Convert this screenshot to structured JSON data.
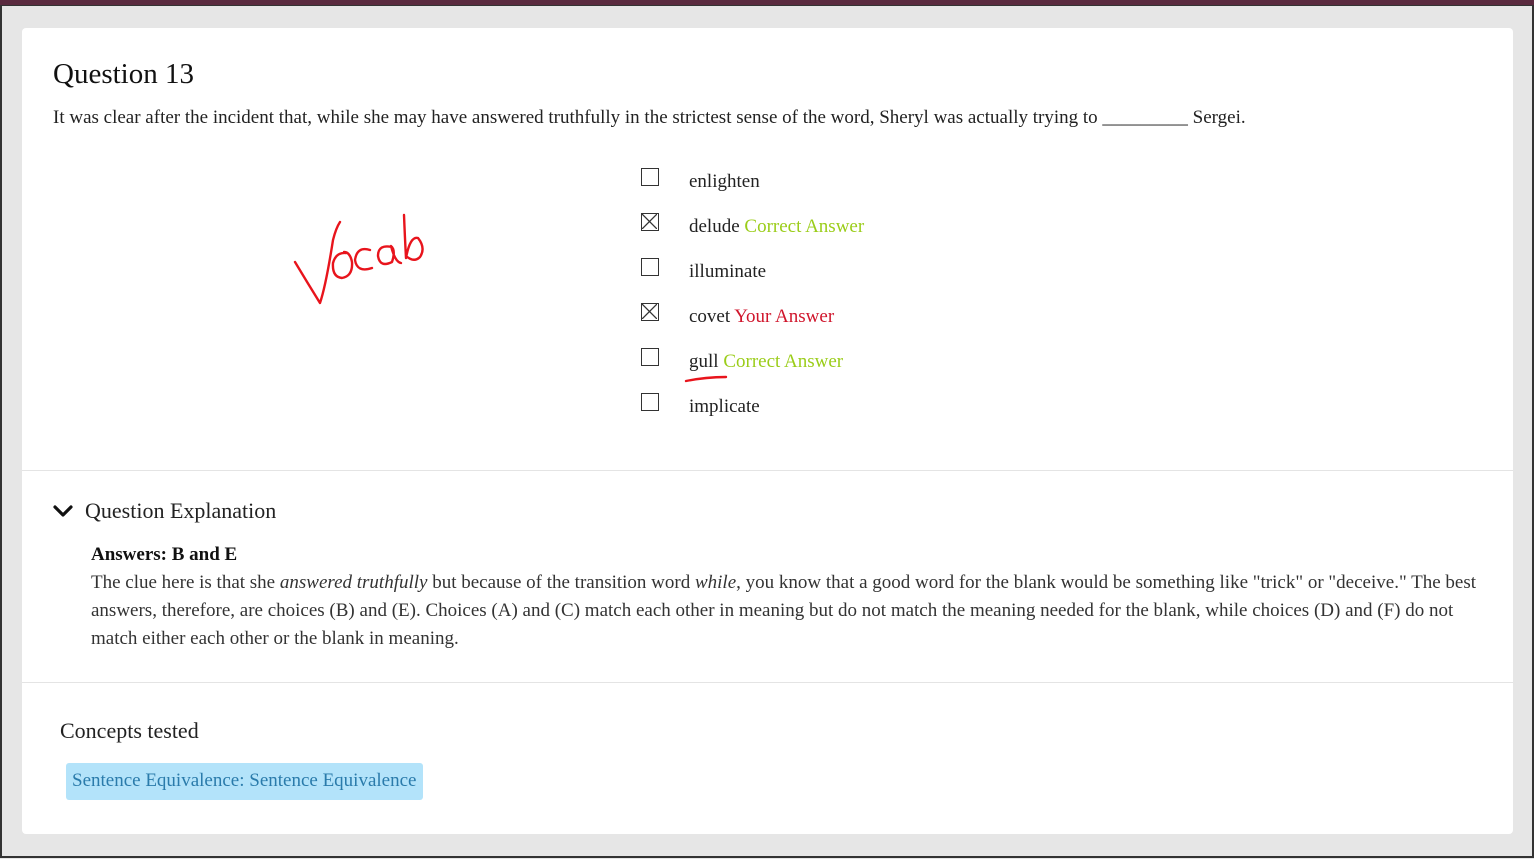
{
  "question": {
    "title": "Question 13",
    "stem": "It was clear after the incident that, while she may have answered truthfully in the strictest sense of the word, Sheryl was actually trying to _________ Sergei."
  },
  "choices": [
    {
      "text": "enlighten",
      "checked": false,
      "tag": "",
      "tag_type": ""
    },
    {
      "text": "delude",
      "checked": true,
      "tag": "Correct Answer",
      "tag_type": "correct"
    },
    {
      "text": "illuminate",
      "checked": false,
      "tag": "",
      "tag_type": ""
    },
    {
      "text": "covet",
      "checked": true,
      "tag": "Your Answer",
      "tag_type": "yours"
    },
    {
      "text": "gull",
      "checked": false,
      "tag": "Correct Answer",
      "tag_type": "correct"
    },
    {
      "text": "implicate",
      "checked": false,
      "tag": "",
      "tag_type": ""
    }
  ],
  "explanation": {
    "toggle_label": "Question Explanation",
    "answers_label": "Answers: B and E",
    "p1": "The clue here is that she ",
    "p1_em": "answered truthfully",
    "p2": " but because of the transition word ",
    "p2_em": "while",
    "p3": ", you know that a good word for the blank would be something like \"trick\" or \"deceive.\" The best answers, therefore, are choices (B) and (E). Choices (A) and (C) match each other in meaning but do not match the meaning needed for the blank, while choices (D) and (F) do not match either each other or the blank in meaning."
  },
  "concepts": {
    "title": "Concepts tested",
    "tag": "Sentence Equivalence: Sentence Equivalence"
  },
  "annotation": {
    "handwritten_text": "Vocab",
    "ink_color": "#e8141c"
  },
  "colors": {
    "correct": "#9bcd1a",
    "yours": "#d0162c",
    "tag_bg": "#b3e3fa",
    "tag_text": "#2a7bab"
  }
}
